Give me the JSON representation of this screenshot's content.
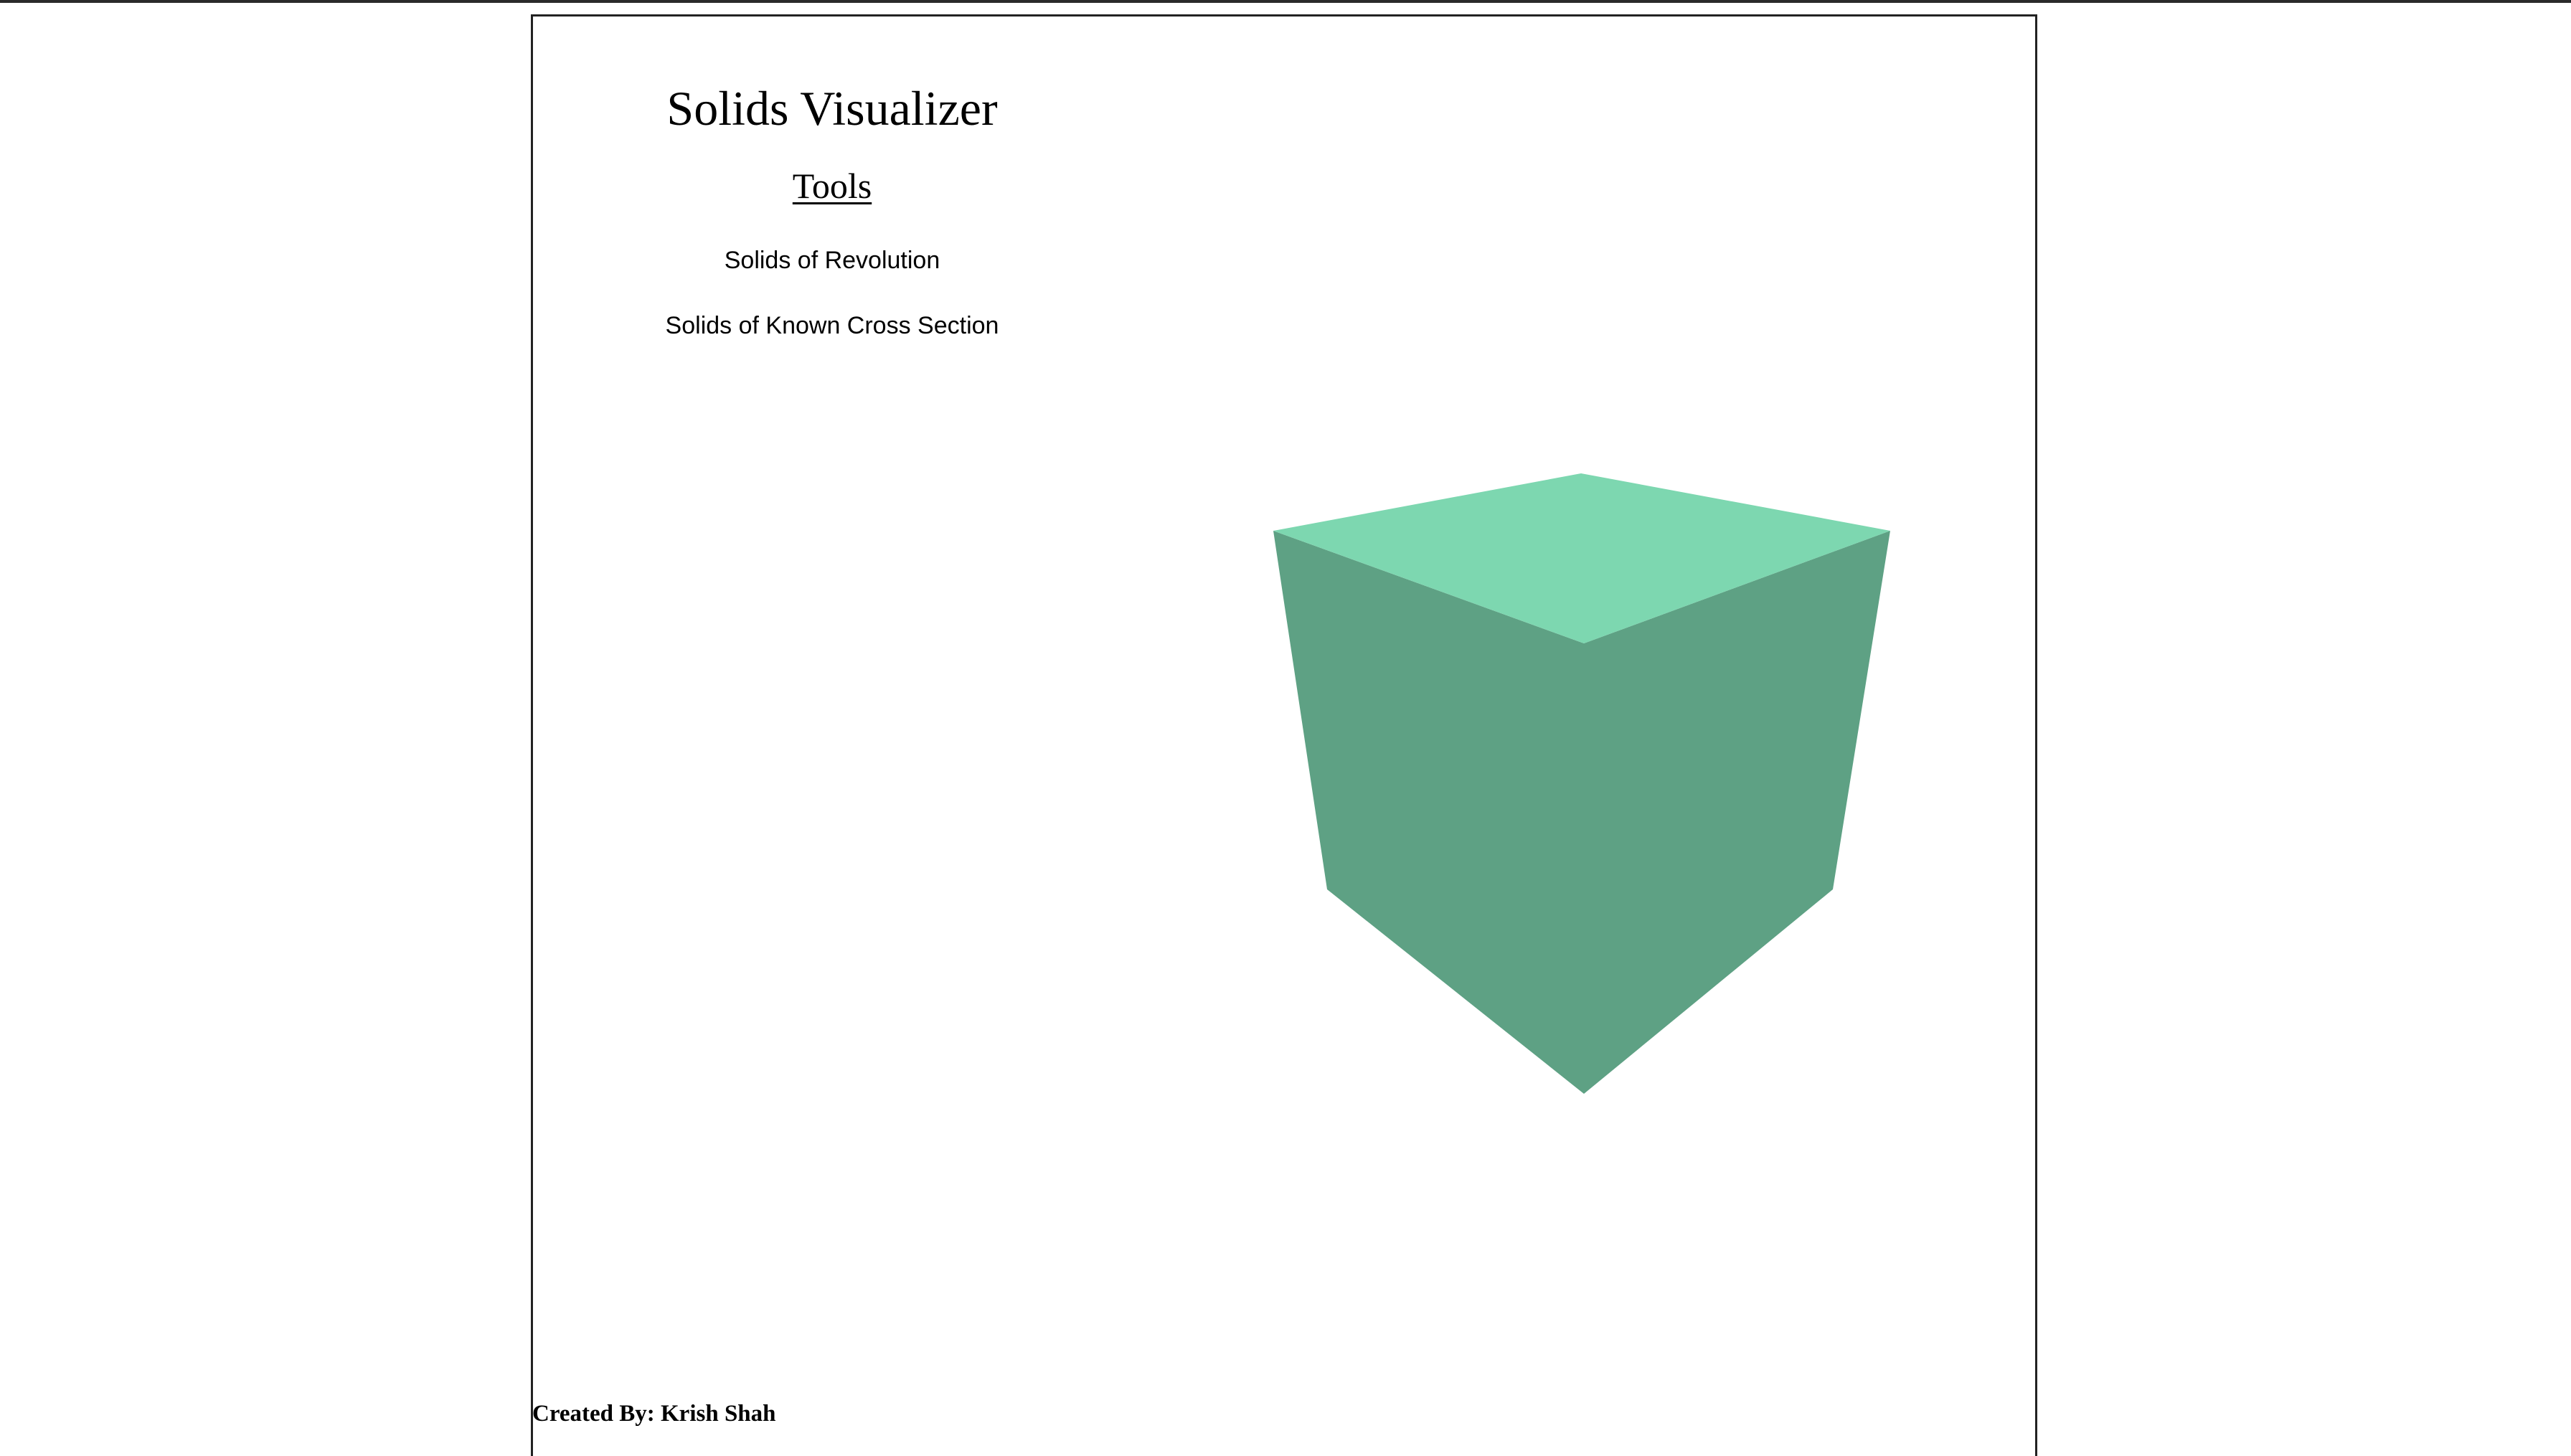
{
  "header": {
    "title": "Solids Visualizer"
  },
  "tools": {
    "heading": "Tools",
    "items": [
      {
        "label": "Solids of Revolution"
      },
      {
        "label": "Solids of Known Cross Section"
      }
    ]
  },
  "viewport": {
    "shape": "cube",
    "colors": {
      "top_face": "#7dd7b0",
      "side_faces": "#5ea184"
    }
  },
  "footer": {
    "credit": "Created By: Krish Shah"
  }
}
